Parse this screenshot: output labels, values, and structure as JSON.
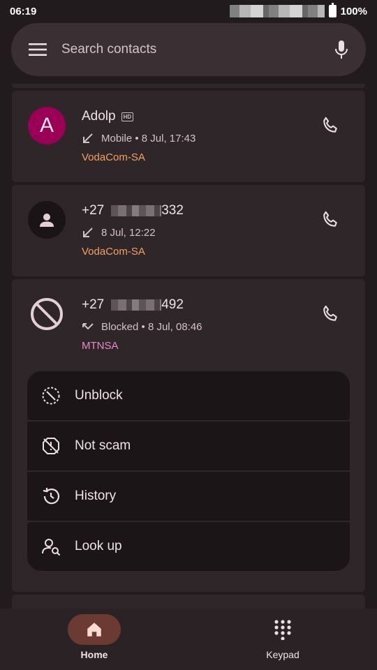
{
  "status_bar": {
    "time": "06:19",
    "battery": "100%"
  },
  "search": {
    "placeholder": "Search contacts"
  },
  "calls": [
    {
      "name": "Adolp",
      "hd": "HD",
      "detail": "Mobile • 8 Jul, 17:43",
      "carrier": "VodaCom-SA"
    },
    {
      "number_prefix": "+27",
      "number_suffix": "332",
      "detail": "8 Jul, 12:22",
      "carrier": "VodaCom-SA"
    },
    {
      "number_prefix": "+27",
      "number_suffix": "492",
      "detail": "Blocked • 8 Jul, 08:46",
      "carrier": "MTNSA"
    }
  ],
  "avatar_letter": "A",
  "actions": [
    {
      "label": "Unblock",
      "icon": "unblock-icon"
    },
    {
      "label": "Not scam",
      "icon": "not-scam-icon"
    },
    {
      "label": "History",
      "icon": "history-icon"
    },
    {
      "label": "Look up",
      "icon": "look-up-icon"
    }
  ],
  "nav": [
    {
      "label": "Home",
      "icon": "home-icon",
      "active": true
    },
    {
      "label": "Keypad",
      "icon": "keypad-icon",
      "active": false
    }
  ],
  "colors": {
    "background": "#221b1e",
    "card": "#2f2629",
    "avatar_accent": "#9a0055",
    "carrier_orange": "#f3a063",
    "carrier_pink": "#e88ac7",
    "nav_active": "#6b3a33"
  }
}
